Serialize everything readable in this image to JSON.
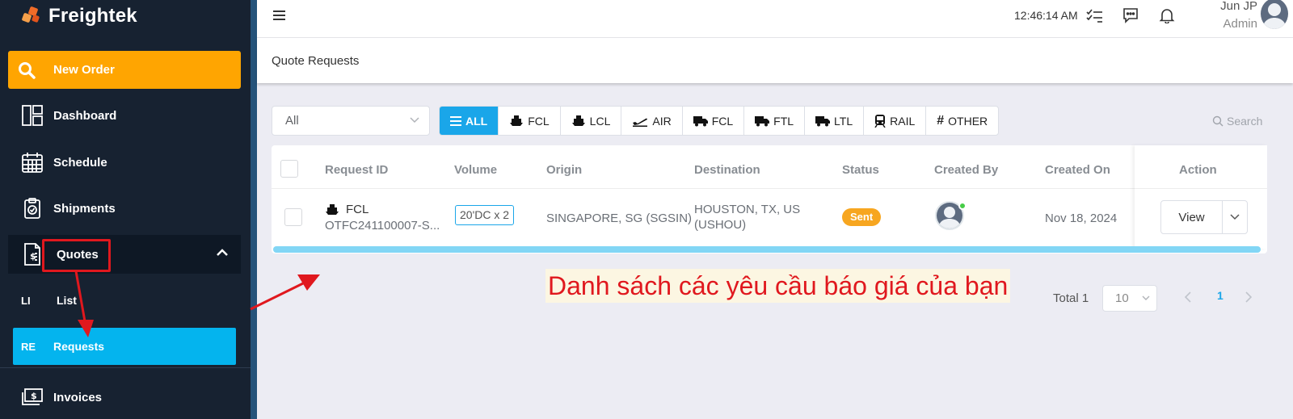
{
  "app": {
    "name": "Freightek"
  },
  "sidebar": {
    "new_order": "New Order",
    "items": [
      {
        "label": "Dashboard",
        "icon": "dashboard-icon"
      },
      {
        "label": "Schedule",
        "icon": "calendar-icon"
      },
      {
        "label": "Shipments",
        "icon": "clipboard-icon"
      },
      {
        "label": "Quotes",
        "icon": "quote-document-icon"
      },
      {
        "label": "Invoices",
        "icon": "invoice-icon"
      }
    ],
    "sub_items": [
      {
        "abbr": "LI",
        "label": "List"
      },
      {
        "abbr": "RE",
        "label": "Requests"
      }
    ]
  },
  "topbar": {
    "time": "12:46:14 AM",
    "user_name": "Jun JP",
    "user_role": "Admin"
  },
  "page": {
    "title": "Quote Requests"
  },
  "filter": {
    "select_value": "All",
    "tabs": [
      {
        "label": "ALL",
        "icon": "list-icon",
        "active": true
      },
      {
        "label": "FCL",
        "icon": "ship-icon"
      },
      {
        "label": "LCL",
        "icon": "ship-icon"
      },
      {
        "label": "AIR",
        "icon": "plane-icon"
      },
      {
        "label": "FCL",
        "icon": "truck-icon"
      },
      {
        "label": "FTL",
        "icon": "truck-icon"
      },
      {
        "label": "LTL",
        "icon": "truck-icon"
      },
      {
        "label": "RAIL",
        "icon": "train-icon"
      },
      {
        "label": "OTHER",
        "icon": "hash-icon"
      }
    ],
    "search_placeholder": "Search"
  },
  "table": {
    "columns": [
      "Request ID",
      "Volume",
      "Origin",
      "Destination",
      "Status",
      "Created By",
      "Created On",
      "Action"
    ],
    "rows": [
      {
        "mode": "FCL",
        "request_id": "OTFC241100007-S...",
        "volume": "20'DC x 2",
        "origin": "SINGAPORE, SG (SGSIN)",
        "destination_line1": "HOUSTON, TX, US",
        "destination_line2": "(USHOU)",
        "status": "Sent",
        "created_on": "Nov 18, 2024",
        "action": "View"
      }
    ]
  },
  "annotation": {
    "text": "Danh sách các yêu cầu báo giá của bạn"
  },
  "pagination": {
    "total": "Total 1",
    "page_size": "10",
    "current_page": "1"
  },
  "colors": {
    "sidebar": "#172231",
    "accent_orange": "#ffa501",
    "accent_blue": "#04b4ee",
    "status_sent": "#f7a620",
    "annotation_red": "#e0181e"
  }
}
